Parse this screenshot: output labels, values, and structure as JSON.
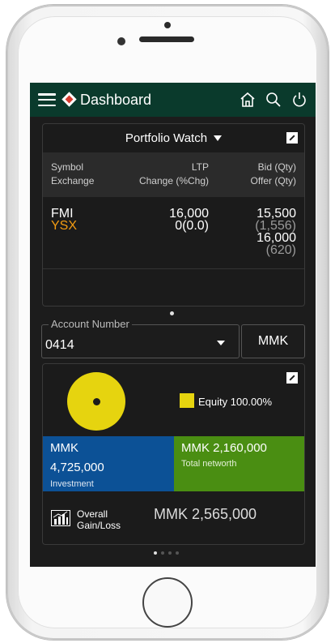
{
  "appbar": {
    "title": "Dashboard"
  },
  "portfolio": {
    "title": "Portfolio Watch",
    "columns": {
      "symbol": "Symbol",
      "exchange": "Exchange",
      "ltp": "LTP",
      "change": "Change (%Chg)",
      "bid": "Bid (Qty)",
      "offer": "Offer (Qty)"
    },
    "rows": [
      {
        "symbol": "FMI",
        "exchange": "YSX",
        "ltp": "16,000",
        "change": "0(0.0)",
        "bid": "15,500",
        "bid_qty": "(1,556)",
        "offer": "16,000",
        "offer_qty": "(620)"
      }
    ]
  },
  "account": {
    "label": "Account Number",
    "value": "0414",
    "currency": "MMK"
  },
  "summary": {
    "legend": "Equity 100.00%",
    "equity_share": 1.0,
    "equity_color": "#e6d40f",
    "investment": {
      "currency": "MMK",
      "amount": "4,725,000",
      "label": "Investment",
      "color": "#0c5196"
    },
    "networth": {
      "amount": "MMK 2,160,000",
      "label": "Total networth",
      "color": "#4a8e12"
    },
    "gainloss": {
      "label_line1": "Overall",
      "label_line2": "Gain/Loss",
      "value": "MMK  2,565,000"
    }
  },
  "pager": {
    "count": 4,
    "active": 0
  }
}
